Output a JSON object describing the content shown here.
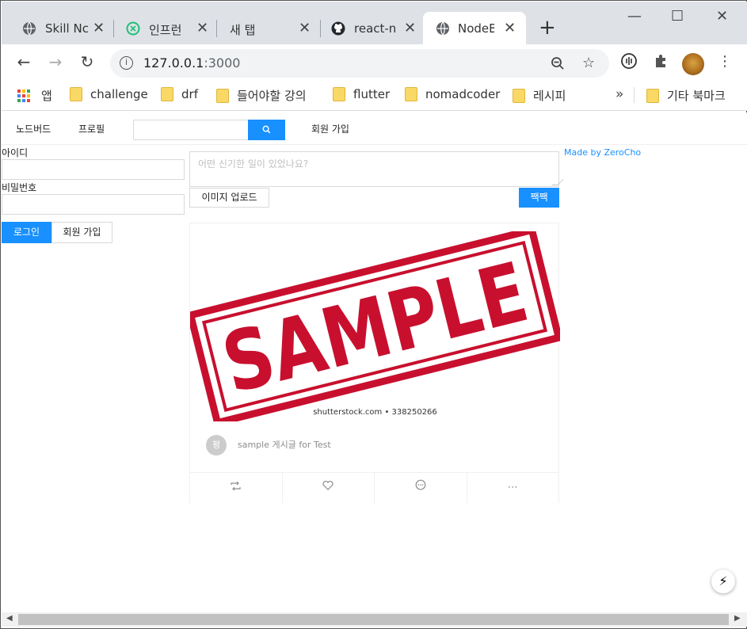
{
  "browser": {
    "tabs": [
      {
        "title": "Skill Nc",
        "icon": "globe-icon"
      },
      {
        "title": "인프런",
        "icon": "inflearn-icon"
      },
      {
        "title": "새 탭",
        "icon": "none"
      },
      {
        "title": "react-n",
        "icon": "github-icon"
      },
      {
        "title": "NodeB",
        "icon": "globe-icon"
      }
    ],
    "new_tab": "+",
    "window_controls": {
      "minimize": "—",
      "maximize": "☐",
      "close": "✕"
    },
    "url_host": "127.0.0.1",
    "url_port": ":3000",
    "bookmarks": {
      "apps": "앱",
      "items": [
        "challenge",
        "drf",
        "들어야할 강의",
        "flutter",
        "nomadcoder",
        "레시피"
      ],
      "more": "»",
      "other": "기타 북마크"
    }
  },
  "app": {
    "menu": {
      "nodebird": "노드버드",
      "profile": "프로필",
      "signup": "회원 가입"
    },
    "search": {
      "placeholder": "",
      "button_icon": "🔍"
    },
    "login": {
      "id_label": "아이디",
      "password_label": "비밀번호",
      "login_button": "로그인",
      "signup_button": "회원 가입"
    },
    "post_form": {
      "placeholder": "어떤 신기한 일이 있었나요?",
      "upload_button": "이미지 업로드",
      "submit_button": "짹짹"
    },
    "post": {
      "image_text": "SAMPLE",
      "image_credit": "shutterstock.com • 338250266",
      "avatar_initial": "평",
      "content": "sample 게시글 for Test",
      "actions": [
        "retweet-icon",
        "heart-icon",
        "message-icon",
        "ellipsis-icon"
      ]
    },
    "made_by": "Made by ZeroCho"
  },
  "colors": {
    "primary": "#1890ff",
    "stamp_red": "#c8102e",
    "tab_strip": "#dee1e6"
  }
}
